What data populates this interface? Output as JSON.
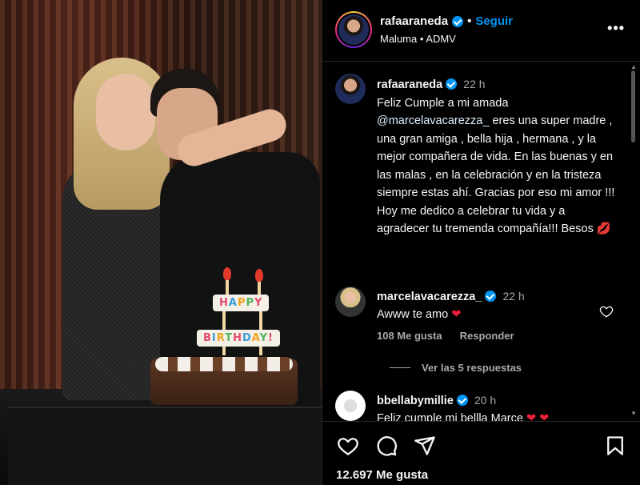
{
  "post": {
    "image_alt": "",
    "banner_happy": "HAPPY",
    "banner_birthday": "BIRTHDAY!"
  },
  "header": {
    "username": "rafaaraneda",
    "separator": "•",
    "follow_label": "Seguir",
    "subtitle": "Maluma • ADMV",
    "more_icon": "more-horizontal-icon"
  },
  "caption": {
    "username": "rafaaraneda",
    "time": "22 h",
    "text_before_mention": "Feliz Cumple a mi amada",
    "mention": "@marcelavacarezza_",
    "text_after_mention": "eres una super madre , una gran amiga , bella hija , hermana , y la mejor compañera de vida. En las buenas y en las malas , en la celebración y en la tristeza siempre estas ahí. Gracias por eso mi amor !!! Hoy me dedico a celebrar tu vida y a agradecer tu tremenda compañía!!! Besos",
    "emoji": "💋"
  },
  "comments": [
    {
      "username": "marcelavacarezza_",
      "time": "22 h",
      "text": "Awww te amo",
      "emoji": "❤",
      "likes": "108 Me gusta",
      "reply_label": "Responder",
      "view_replies": "Ver las 5 respuestas"
    },
    {
      "username": "bbellabymillie",
      "time": "20 h",
      "text": "Feliz cumple mi bellla Marce",
      "emoji": "❤ ❤"
    }
  ],
  "actions": {
    "like_icon": "heart-icon",
    "comment_icon": "comment-icon",
    "share_icon": "send-icon",
    "save_icon": "bookmark-icon",
    "likes_count": "12.697 Me gusta"
  },
  "colors": {
    "background": "#000000",
    "accent_blue": "#0095f6",
    "verified_blue": "#0095f6",
    "heart_red": "#ed1f3a",
    "muted_text": "#a8a8a8"
  }
}
